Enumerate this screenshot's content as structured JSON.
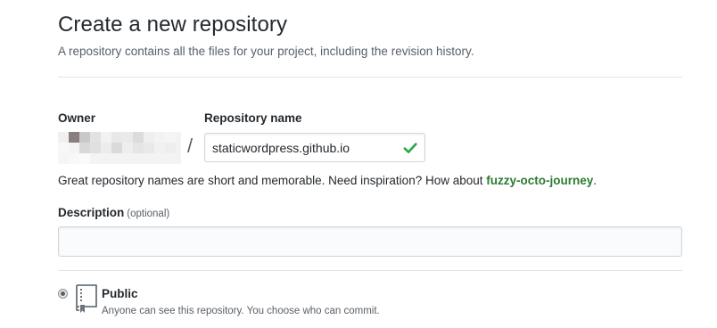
{
  "header": {
    "title": "Create a new repository",
    "subtitle": "A repository contains all the files for your project, including the revision history."
  },
  "owner": {
    "label": "Owner",
    "separator": "/"
  },
  "repository_name": {
    "label": "Repository name",
    "value": "staticwordpress.github.io",
    "valid_icon": "check-icon",
    "valid_color": "#28a745"
  },
  "hint": {
    "text": "Great repository names are short and memorable. Need inspiration? How about ",
    "suggestion": "fuzzy-octo-journey",
    "suffix": "."
  },
  "description": {
    "label": "Description",
    "optional_label": "(optional)",
    "value": ""
  },
  "visibility": {
    "public_label": "Public",
    "public_desc": "Anyone can see this repository. You choose who can commit.",
    "public_icon": "repo-icon"
  }
}
